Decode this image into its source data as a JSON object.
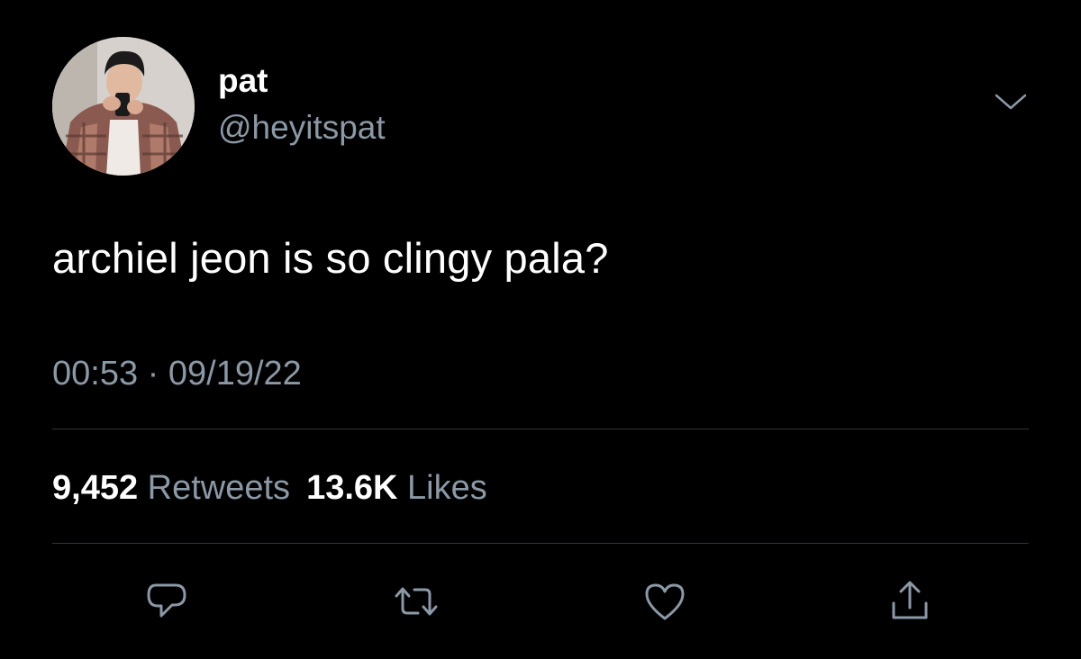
{
  "author": {
    "display_name": "pat",
    "handle": "@heyitspat"
  },
  "tweet": {
    "text": "archiel jeon is so clingy pala?",
    "time": "00:53",
    "separator": " · ",
    "date": "09/19/22"
  },
  "stats": {
    "retweets_count": "9,452",
    "retweets_label": "Retweets",
    "likes_count": "13.6K",
    "likes_label": "Likes"
  },
  "icons": {
    "more": "chevron-down-icon",
    "reply": "reply-icon",
    "retweet": "retweet-icon",
    "like": "heart-icon",
    "share": "share-icon"
  },
  "colors": {
    "background": "#000000",
    "text": "#ffffff",
    "muted": "#8b98a5",
    "divider": "#2f3336"
  }
}
